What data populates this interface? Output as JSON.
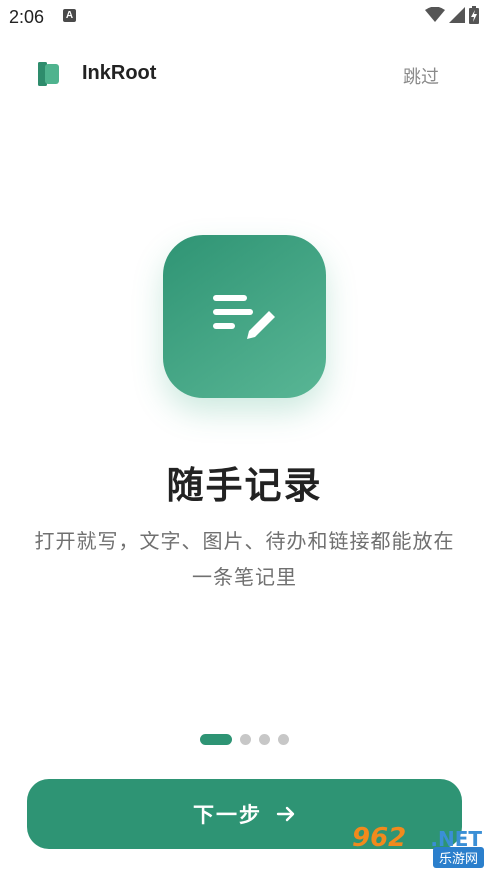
{
  "status_bar": {
    "time": "2:06",
    "notification_icon": "a-icon",
    "wifi_icon": "wifi-icon",
    "signal_icon": "signal-icon",
    "battery_icon": "battery-charging-icon"
  },
  "header": {
    "logo_icon": "book-icon",
    "app_name": "InkRoot",
    "skip_label": "跳过"
  },
  "slide": {
    "icon": "note-edit-icon",
    "title": "随手记录",
    "description": "打开就写，文字、图片、待办和链接都能放在一条笔记里"
  },
  "pager": {
    "total": 4,
    "current": 1
  },
  "next_button": {
    "label": "下一步",
    "icon": "arrow-right-icon"
  },
  "watermark": {
    "top": "962",
    "net": ".NET",
    "bottom": "乐游网"
  },
  "colors": {
    "accent": "#2e9474",
    "accent_light": "#59b695",
    "dot_inactive": "#c7c7c7"
  }
}
